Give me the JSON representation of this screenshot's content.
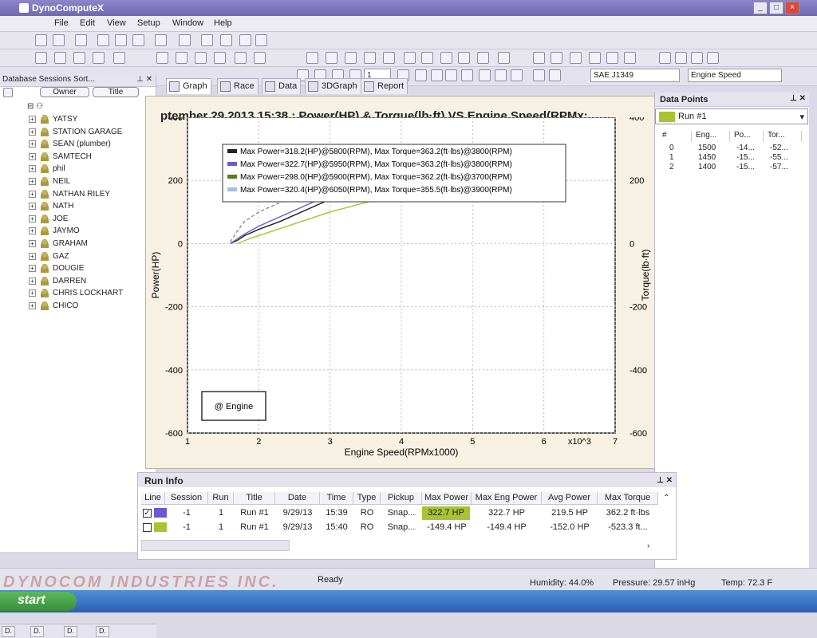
{
  "window": {
    "title": "DynoComputeX",
    "min": "_",
    "max": "□",
    "close": "×"
  },
  "menu": [
    "File",
    "Edit",
    "View",
    "Setup",
    "Window",
    "Help"
  ],
  "toolbar": {
    "tap_search_placeholder": "",
    "standard_combo": "SAE J1349",
    "xaxis_combo": "Engine Speed",
    "zoom_value": "1"
  },
  "left_panel": {
    "title": "Database Sessions Sort...",
    "sort_owner": "Owner",
    "sort_title": "Title",
    "items": [
      "YATSY",
      "STATION GARAGE",
      "SEAN (plumber)",
      "SAMTECH",
      "phil",
      "NEIL",
      "NATHAN RILEY",
      "NATH",
      "JOE",
      "JAYMO",
      "GRAHAM",
      "GAZ",
      "DOUGIE",
      "DARREN",
      "CHRIS LOCKHART",
      "CHICO"
    ],
    "tabs": [
      "D.",
      "D.",
      "D.",
      "D."
    ]
  },
  "doc_tabs": [
    "Graph",
    "Race",
    "Data",
    "3DGraph",
    "Report"
  ],
  "chart_header": "ptember 29,2013,15:38  : Power(HP) & Torque(lb·ft) VS Engine Speed(RPMx:",
  "chart_data": {
    "type": "line",
    "xlabel": "Engine Speed(RPMx1000)",
    "ylabel": "Power(HP)",
    "y2label": "Torque(lb·ft)",
    "x_multiplier_label": "x10^3",
    "xlim": [
      1,
      7
    ],
    "ylim": [
      -600,
      400
    ],
    "y2lim": [
      -600,
      400
    ],
    "xticks": [
      "1",
      "2",
      "3",
      "4",
      "5",
      "6",
      "7"
    ],
    "yticks": [
      "400",
      "200",
      "0",
      "-200",
      "-400",
      "-600"
    ],
    "y2ticks": [
      "400",
      "200",
      "0",
      "-200",
      "-400",
      "-600"
    ],
    "legend": [
      "Max Power=318.2(HP)@5800(RPM), Max Torque=363.2(ft·lbs)@3800(RPM)",
      "Max Power=322.7(HP)@5950(RPM), Max Torque=363.2(ft·lbs)@3800(RPM)",
      "Max Power=298.0(HP)@5900(RPM), Max Torque=362.2(ft·lbs)@3700(RPM)",
      "Max Power=320.4(HP)@6050(RPM), Max Torque=355.5(ft·lbs)@3900(RPM)"
    ],
    "legend_colors": [
      "#222222",
      "#6a5ad0",
      "#5f7a20",
      "#9ec3dc"
    ],
    "grid": true,
    "legend_placement": "top-left",
    "annotation": "@ Engine",
    "series": [
      {
        "color": "#222222",
        "x": [
          1.6,
          1.7,
          1.8,
          2.0,
          2.3,
          2.6,
          3.0
        ],
        "y": [
          0,
          10,
          25,
          45,
          70,
          100,
          140
        ]
      },
      {
        "color": "#6a5ad0",
        "x": [
          1.6,
          1.7,
          1.8,
          2.0,
          2.3,
          2.6,
          3.0
        ],
        "y": [
          0,
          15,
          30,
          55,
          85,
          115,
          155
        ]
      },
      {
        "color": "#a8c432",
        "x": [
          1.7,
          1.9,
          2.2,
          2.6,
          3.0,
          3.5,
          4.0
        ],
        "y": [
          0,
          18,
          40,
          70,
          100,
          130,
          160
        ]
      },
      {
        "color": "#888888",
        "x": [
          1.6,
          1.7,
          1.8,
          2.0,
          2.3,
          2.6
        ],
        "y": [
          5,
          40,
          70,
          100,
          130,
          150
        ]
      }
    ]
  },
  "right_panel": {
    "title": "Data Points",
    "run": "Run #1",
    "headers": [
      "#",
      "Eng...",
      "Po...",
      "Tor..."
    ],
    "rows": [
      [
        "0",
        "1500",
        "-14...",
        "-52..."
      ],
      [
        "1",
        "1450",
        "-15...",
        "-55..."
      ],
      [
        "2",
        "1400",
        "-15...",
        "-57..."
      ]
    ]
  },
  "run_info": {
    "title": "Run Info",
    "headers": [
      "Line",
      "Session",
      "Run",
      "Title",
      "Date",
      "Time",
      "Type",
      "Pickup",
      "Max Power",
      "Max Eng Power",
      "Avg Power",
      "Max Torque"
    ],
    "rows": [
      {
        "checked": "✓",
        "color": "#6a5ad0",
        "session": "-1",
        "run": "1",
        "title": "Run #1",
        "date": "9/29/13",
        "time": "15:39",
        "type": "RO",
        "pickup": "Snap...",
        "max_power": "322.7 HP",
        "max_eng_power": "322.7 HP",
        "avg_power": "219.5 HP",
        "max_torque": "362.2 ft·lbs"
      },
      {
        "checked": "",
        "color": "#a8c432",
        "session": "-1",
        "run": "1",
        "title": "Run #1",
        "date": "9/29/13",
        "time": "15:40",
        "type": "RO",
        "pickup": "Snap...",
        "max_power": "-149.4 HP",
        "max_eng_power": "-149.4 HP",
        "avg_power": "-152.0 HP",
        "max_torque": "-523.3 ft..."
      }
    ]
  },
  "status": {
    "brand": "DYNOCOM INDUSTRIES INC.",
    "ready": "Ready",
    "humidity": "Humidity: 44.0%",
    "pressure": "Pressure: 29.57 inHg",
    "temp": "Temp: 72.3 F"
  },
  "taskbar": {
    "start": "start"
  }
}
